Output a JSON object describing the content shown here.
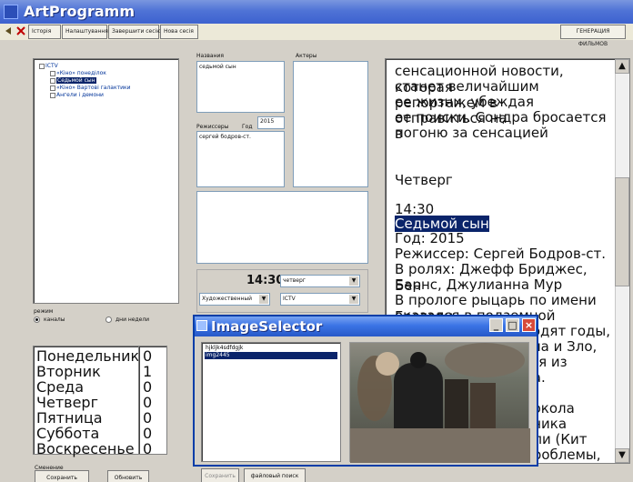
{
  "app": {
    "title": "ArtProgramm"
  },
  "toolbar": {
    "buttons": [
      "Історія",
      "Налаштування",
      "Завершити сесію",
      "Нова сесія"
    ],
    "generate_label": "ГЕНЕРАЦИЯ ФИЛЬМОВ"
  },
  "tree": {
    "root": "ICTV",
    "items": [
      "«Кіно» понеділок",
      "Седьмой сын",
      "«Кіно» Вартові галактики",
      "Ангели і демони"
    ]
  },
  "form": {
    "title_label": "Названия",
    "actors_label": "Актеры",
    "director_label": "Режиссеры",
    "year_label": "Год",
    "year_value": "2015",
    "title_value": "седьмой сын",
    "director_value": "сергей бодров-ст.",
    "time_value": "14:30",
    "day_value": "четверг",
    "genre_value": "Художественный",
    "channel_value": "ICTV"
  },
  "mode": {
    "label": "режим",
    "options": [
      "каналы",
      "дни недели"
    ]
  },
  "days": {
    "names": [
      "Понедельник",
      "Вторник",
      "Среда",
      "Четверг",
      "Пятница",
      "Суббота",
      "Воскресенье"
    ],
    "counts": [
      "0",
      "1",
      "0",
      "0",
      "0",
      "0",
      "0"
    ]
  },
  "bottom_controls": {
    "group_label": "Сменение",
    "buttons": [
      "Сохранить",
      "Обновить",
      "Сохранить",
      "файловый поиск"
    ]
  },
  "viewer": {
    "lines": [
      "сенсационной новости, которая",
      "станет величайшим репортажем в",
      "ее жизни, убеждая отправиться на",
      "ее поиски. Сондра бросается в",
      "погоню за сенсацией",
      "",
      "Четверг",
      "",
      "14:30",
      "Седьмой сын",
      "Год: 2015",
      "Режиссер: Сергей Бодров-ст.",
      "В ролях: Джефф Бриджес, Бен",
      "Барнс, Джулианна Мур",
      "В прологе рыцарь по имени Грегори",
      "оказался в подземной темнице",
      "ходят годы,",
      "уна и Зло,",
      "гся из",
      "на.",
      "",
      "локола",
      "еника",
      "дли (Кит",
      "проблемы,"
    ]
  },
  "dialog": {
    "title": "ImageSelector",
    "files": [
      "hjkljk4sdfdgjk",
      "img2445"
    ]
  }
}
